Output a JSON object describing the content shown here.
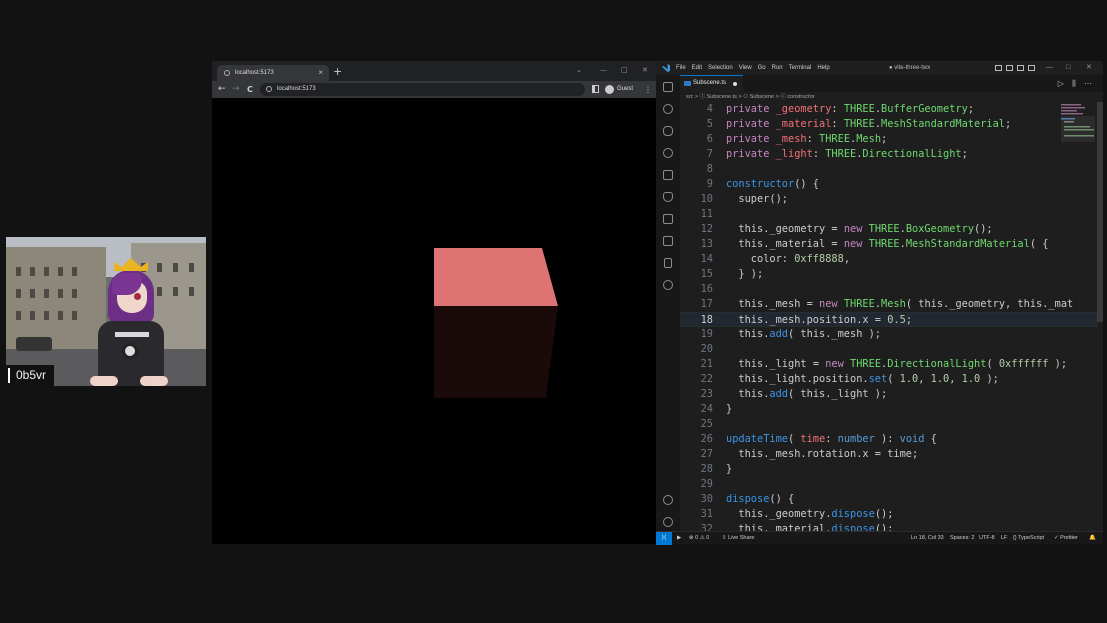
{
  "webcam": {
    "name": "0b5vr"
  },
  "browser": {
    "tab_title": "localhost:5173",
    "tab_close": "×",
    "new_tab": "+",
    "address": "localhost:5173",
    "profile": "Guest",
    "nav": {
      "back": "←",
      "forward": "→",
      "reload": "C"
    },
    "window_controls": [
      "⌄",
      "—",
      "□",
      "✕"
    ],
    "menu": "⋮",
    "scene": {
      "cube_color": "#e07878",
      "bg": "#000000"
    }
  },
  "vscode": {
    "menu": [
      "File",
      "Edit",
      "Selection",
      "View",
      "Go",
      "Run",
      "Terminal",
      "Help"
    ],
    "window_title": "● vite-three-twx",
    "window_controls": [
      "—",
      "□",
      "✕"
    ],
    "tab": {
      "name": "Subscene.ts"
    },
    "tab_actions": "▷ ⫼ ⋯",
    "breadcrumb": "src > ⓣ Subscene.ts > ⚇ Subscene > ⓒ constructor",
    "lines": [
      {
        "n": "4",
        "segs": [
          [
            "kw-private",
            "private "
          ],
          [
            "pink",
            "_geometry"
          ],
          [
            "punct",
            ": "
          ],
          [
            "green",
            "THREE"
          ],
          [
            "punct",
            "."
          ],
          [
            "green",
            "BufferGeometry"
          ],
          [
            "punct",
            ";"
          ]
        ]
      },
      {
        "n": "5",
        "segs": [
          [
            "kw-private",
            "private "
          ],
          [
            "pink",
            "_material"
          ],
          [
            "punct",
            ": "
          ],
          [
            "green",
            "THREE"
          ],
          [
            "punct",
            "."
          ],
          [
            "green",
            "MeshStandardMaterial"
          ],
          [
            "punct",
            ";"
          ]
        ]
      },
      {
        "n": "6",
        "segs": [
          [
            "kw-private",
            "private "
          ],
          [
            "pink",
            "_mesh"
          ],
          [
            "punct",
            ": "
          ],
          [
            "green",
            "THREE"
          ],
          [
            "punct",
            "."
          ],
          [
            "green",
            "Mesh"
          ],
          [
            "punct",
            ";"
          ]
        ]
      },
      {
        "n": "7",
        "segs": [
          [
            "kw-private",
            "private "
          ],
          [
            "pink",
            "_light"
          ],
          [
            "punct",
            ": "
          ],
          [
            "green",
            "THREE"
          ],
          [
            "punct",
            "."
          ],
          [
            "green",
            "DirectionalLight"
          ],
          [
            "punct",
            ";"
          ]
        ]
      },
      {
        "n": "8",
        "segs": []
      },
      {
        "n": "9",
        "segs": [
          [
            "blue-fn",
            "constructor"
          ],
          [
            "punct",
            "() {"
          ]
        ]
      },
      {
        "n": "10",
        "segs": [
          [
            "punct",
            "  super();"
          ]
        ]
      },
      {
        "n": "11",
        "segs": []
      },
      {
        "n": "12",
        "segs": [
          [
            "punct",
            "  this."
          ],
          [
            "punct",
            "_geometry "
          ],
          [
            "op",
            "= "
          ],
          [
            "newkw",
            "new "
          ],
          [
            "green",
            "THREE"
          ],
          [
            "punct",
            "."
          ],
          [
            "green",
            "BoxGeometry"
          ],
          [
            "punct",
            "();"
          ]
        ]
      },
      {
        "n": "13",
        "segs": [
          [
            "punct",
            "  this."
          ],
          [
            "punct",
            "_material "
          ],
          [
            "op",
            "= "
          ],
          [
            "newkw",
            "new "
          ],
          [
            "green",
            "THREE"
          ],
          [
            "punct",
            "."
          ],
          [
            "green",
            "MeshStandardMaterial"
          ],
          [
            "punct",
            "( {"
          ]
        ]
      },
      {
        "n": "14",
        "segs": [
          [
            "punct",
            "    color: "
          ],
          [
            "num-l",
            "0xff8888"
          ],
          [
            "punct",
            ","
          ]
        ]
      },
      {
        "n": "15",
        "segs": [
          [
            "punct",
            "  } );"
          ]
        ]
      },
      {
        "n": "16",
        "segs": []
      },
      {
        "n": "17",
        "segs": [
          [
            "punct",
            "  this."
          ],
          [
            "punct",
            "_mesh "
          ],
          [
            "op",
            "= "
          ],
          [
            "newkw",
            "new "
          ],
          [
            "green",
            "THREE"
          ],
          [
            "punct",
            "."
          ],
          [
            "green",
            "Mesh"
          ],
          [
            "punct",
            "( this._geometry, this._mat"
          ]
        ]
      },
      {
        "n": "18",
        "cur": true,
        "segs": [
          [
            "punct",
            "  this."
          ],
          [
            "punct",
            "_mesh.position.x "
          ],
          [
            "op",
            "= "
          ],
          [
            "num-l",
            "0.5"
          ],
          [
            "punct",
            ";"
          ]
        ]
      },
      {
        "n": "19",
        "segs": [
          [
            "punct",
            "  this."
          ],
          [
            "blue-fn",
            "add"
          ],
          [
            "punct",
            "( this._mesh );"
          ]
        ]
      },
      {
        "n": "20",
        "segs": []
      },
      {
        "n": "21",
        "segs": [
          [
            "punct",
            "  this."
          ],
          [
            "punct",
            "_light "
          ],
          [
            "op",
            "= "
          ],
          [
            "newkw",
            "new "
          ],
          [
            "green",
            "THREE"
          ],
          [
            "punct",
            "."
          ],
          [
            "green",
            "DirectionalLight"
          ],
          [
            "punct",
            "( "
          ],
          [
            "num-l",
            "0xffffff"
          ],
          [
            "punct",
            " );"
          ]
        ]
      },
      {
        "n": "22",
        "segs": [
          [
            "punct",
            "  this."
          ],
          [
            "punct",
            "_light.position."
          ],
          [
            "blue-fn",
            "set"
          ],
          [
            "punct",
            "( "
          ],
          [
            "num-l",
            "1.0"
          ],
          [
            "punct",
            ", "
          ],
          [
            "num-l",
            "1.0"
          ],
          [
            "punct",
            ", "
          ],
          [
            "num-l",
            "1.0"
          ],
          [
            "punct",
            " );"
          ]
        ]
      },
      {
        "n": "23",
        "segs": [
          [
            "punct",
            "  this."
          ],
          [
            "blue-fn",
            "add"
          ],
          [
            "punct",
            "( this._light );"
          ]
        ]
      },
      {
        "n": "24",
        "segs": [
          [
            "punct",
            "}"
          ]
        ]
      },
      {
        "n": "25",
        "segs": []
      },
      {
        "n": "26",
        "segs": [
          [
            "blue-fn",
            "updateTime"
          ],
          [
            "punct",
            "( "
          ],
          [
            "pink",
            "time"
          ],
          [
            "punct",
            ": "
          ],
          [
            "kw",
            "number"
          ],
          [
            "punct",
            " ): "
          ],
          [
            "kw",
            "void"
          ],
          [
            "punct",
            " {"
          ]
        ]
      },
      {
        "n": "27",
        "segs": [
          [
            "punct",
            "  this."
          ],
          [
            "punct",
            "_mesh.rotation.x "
          ],
          [
            "op",
            "= "
          ],
          [
            "punct",
            "time;"
          ]
        ]
      },
      {
        "n": "28",
        "segs": [
          [
            "punct",
            "}"
          ]
        ]
      },
      {
        "n": "29",
        "segs": []
      },
      {
        "n": "30",
        "segs": [
          [
            "blue-fn",
            "dispose"
          ],
          [
            "punct",
            "() {"
          ]
        ]
      },
      {
        "n": "31",
        "segs": [
          [
            "punct",
            "  this."
          ],
          [
            "punct",
            "_geometry."
          ],
          [
            "blue-fn",
            "dispose"
          ],
          [
            "punct",
            "();"
          ]
        ]
      },
      {
        "n": "32",
        "segs": [
          [
            "punct",
            "  this."
          ],
          [
            "punct",
            "_material."
          ],
          [
            "blue-fn",
            "dispose"
          ],
          [
            "punct",
            "();"
          ]
        ]
      }
    ],
    "status": {
      "problems": "⊗ 0 ⚠ 0",
      "live_share": "Live Share",
      "position": "Ln 18, Col 33",
      "spaces": "Spaces: 2",
      "encoding": "UTF-8",
      "eol": "LF",
      "language": "{} TypeScript",
      "formatter": "✓ Prettier",
      "bell": "🔔"
    }
  }
}
